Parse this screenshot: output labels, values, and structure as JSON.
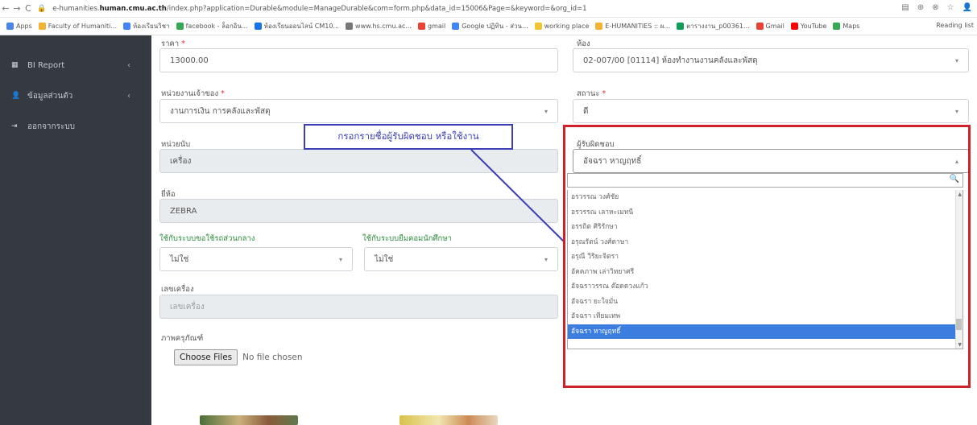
{
  "browser": {
    "url_prefix": "e-humanities.",
    "url_host": "human.cmu.ac.th",
    "url_rest": "/index.php?application=Durable&module=ManageDurable&com=form.php&data_id=15006&Page=&keyword=&org_id=1",
    "bookmarks": [
      {
        "label": "Apps",
        "color": "#4a86e8"
      },
      {
        "label": "Faculty of Humaniti...",
        "color": "#f2b233"
      },
      {
        "label": "ห้องเรียนวิชา",
        "color": "#4285f4"
      },
      {
        "label": "facebook - ล็อกอิน...",
        "color": "#34a853"
      },
      {
        "label": "ห้องเรียนออนไลน์ CM10...",
        "color": "#1a73e8"
      },
      {
        "label": "www.hs.cmu.ac...",
        "color": "#777777"
      },
      {
        "label": "gmail",
        "color": "#ea4335"
      },
      {
        "label": "Google ปฏิทิน - ส่วน...",
        "color": "#4285f4"
      },
      {
        "label": "working place",
        "color": "#f4c430"
      },
      {
        "label": "E-HUMANITIES :: ผ...",
        "color": "#f2b233"
      },
      {
        "label": "ตารางงาน_p00361...",
        "color": "#0f9d58"
      },
      {
        "label": "Gmail",
        "color": "#ea4335"
      },
      {
        "label": "YouTube",
        "color": "#ff0000"
      },
      {
        "label": "Maps",
        "color": "#34a853"
      }
    ],
    "reading_list": "Reading list"
  },
  "sidebar": {
    "items": [
      {
        "label": "BI Report",
        "icon": "table-icon",
        "glyph": "▦",
        "chevron": "‹"
      },
      {
        "label": "ข้อมูลส่วนตัว",
        "icon": "user-icon",
        "glyph": "👤",
        "chevron": "‹"
      },
      {
        "label": "ออกจากระบบ",
        "icon": "logout-icon",
        "glyph": "⇥",
        "chevron": ""
      }
    ]
  },
  "form": {
    "price_label": "ราคา",
    "price_value": "13000.00",
    "room_label": "ห้อง",
    "room_value": "02-007/00 [01114] ห้องทำงานงานคลังและพัสดุ",
    "owner_unit_label": "หน่วยงานเจ้าของ",
    "owner_unit_value": "งานการเงิน การคลังและพัสดุ",
    "status_label": "สถานะ",
    "status_value": "ดี",
    "unit_label": "หน่วยนับ",
    "unit_value": "เครื่อง",
    "responsible_label": "ผู้รับผิดชอบ",
    "responsible_value": "อัจฉรา หาญฤทธิ์",
    "brand_label": "ยี่ห้อ",
    "brand_value": "ZEBRA",
    "central_label": "ใช้กับระบบขอใช้รถส่วนกลาง",
    "central_value": "ไม่ใช่",
    "student_label": "ใช้กับระบบยืมคอมนักศึกษา",
    "student_value": "ไม่ใช่",
    "machine_no_label": "เลขเครื่อง",
    "machine_no_placeholder": "เลขเครื่อง",
    "image_label": "ภาพครุภัณฑ์",
    "choose_files": "Choose Files",
    "no_file": "No file chosen",
    "required_mark": "*"
  },
  "callout": {
    "text": "กรอกรายชื่อผู้รับผิดชอบ หรือใช้งาน"
  },
  "dropdown": {
    "options": [
      "อรวรรณ วงศ์ชัย",
      "อรวรรณ เลาหะเมทนี",
      "อรรถิต ศิริรักษา",
      "อรุณรัตน์ วงศ์ดาษา",
      "อรุณี วิริยะจิตรา",
      "อัคคภาพ เล่าวิทยาศรี",
      "อัจฉราวรรณ ต๊อดดวงแก้ว",
      "อัจฉรา ยะใจมั่น",
      "อัจฉรา เทียมเทพ",
      "อัจฉรา หาญฤทธิ์"
    ],
    "selected_index": 9
  }
}
